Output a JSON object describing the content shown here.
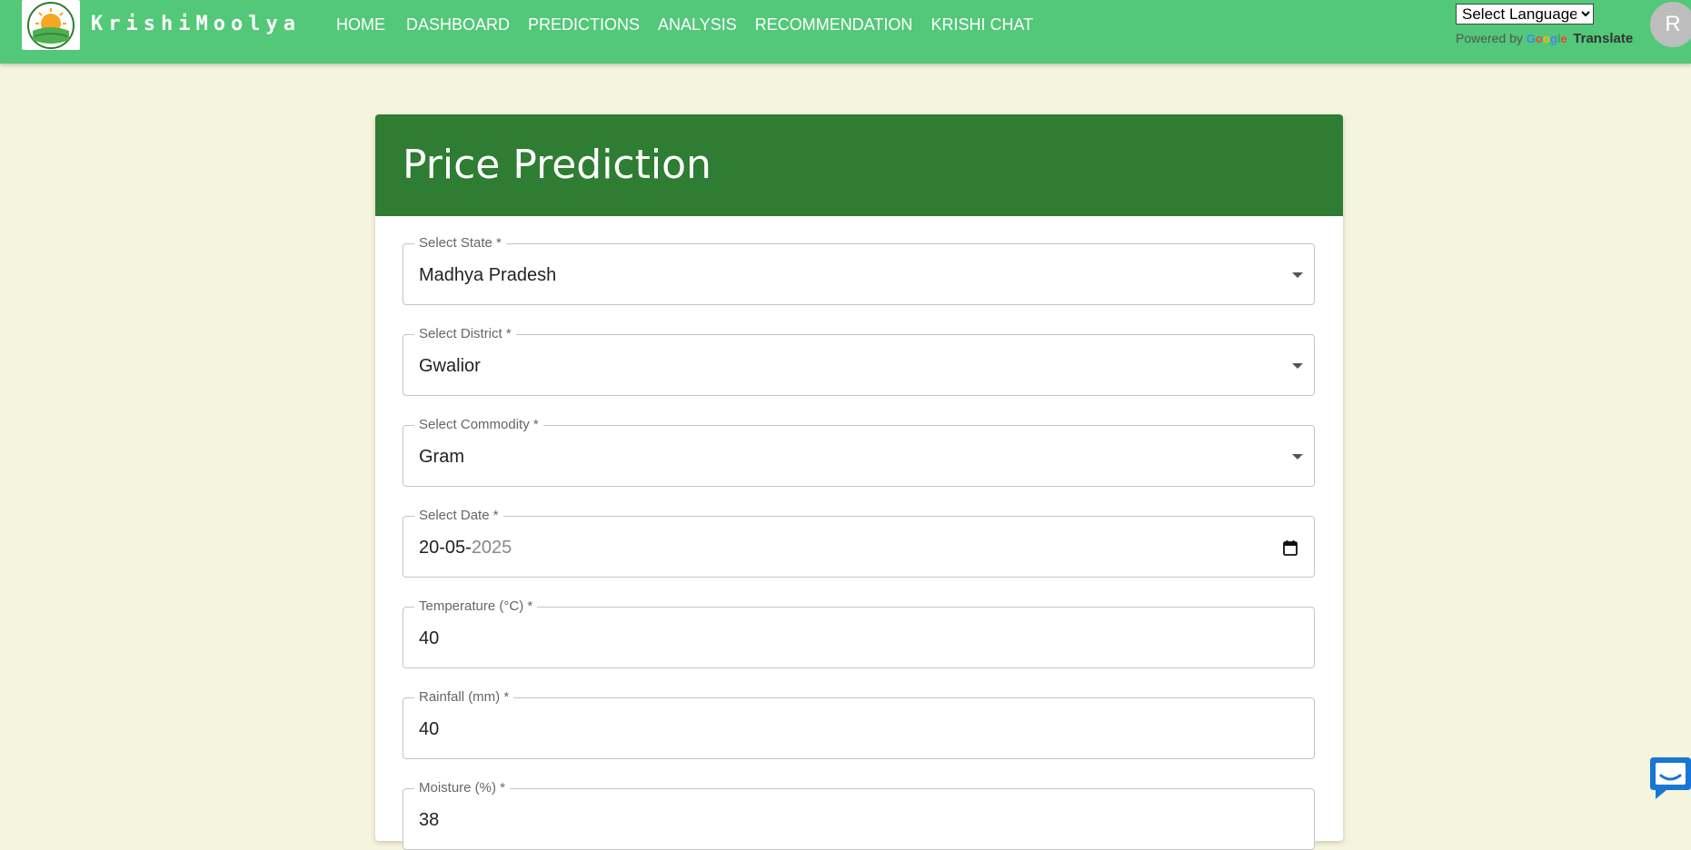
{
  "brand": {
    "name": "KrishiMoolya",
    "logo_icon": "krishimoolya-logo-icon"
  },
  "nav": {
    "items": [
      {
        "label": "HOME"
      },
      {
        "label": "DASHBOARD"
      },
      {
        "label": "PREDICTIONS"
      },
      {
        "label": "ANALYSIS"
      },
      {
        "label": "RECOMMENDATION"
      },
      {
        "label": "KRISHI CHAT"
      }
    ]
  },
  "translate": {
    "select_label": "Select Language",
    "powered_by": "Powered by",
    "google": "Google",
    "translate": "Translate"
  },
  "user": {
    "avatar_initial": "R"
  },
  "form": {
    "title": "Price Prediction",
    "fields": [
      {
        "label": "Select State *",
        "value": "Madhya Pradesh",
        "type": "select"
      },
      {
        "label": "Select District *",
        "value": "Gwalior",
        "type": "select"
      },
      {
        "label": "Select Commodity *",
        "value": "Gram",
        "type": "select"
      },
      {
        "label": "Select Date *",
        "value": "20-05-",
        "value_muted": "2025",
        "type": "date"
      },
      {
        "label": "Temperature (°C) *",
        "value": "40",
        "type": "number"
      },
      {
        "label": "Rainfall (mm) *",
        "value": "40",
        "type": "number"
      },
      {
        "label": "Moisture (%) *",
        "value": "38",
        "type": "number"
      }
    ]
  },
  "colors": {
    "navbar": "#52c878",
    "card_header": "#2e7d32",
    "page_bg": "#f5f4dc",
    "chat_widget": "#1976d2"
  },
  "icons": {
    "dropdown": "chevron-down-icon",
    "calendar": "calendar-icon",
    "chat": "chat-bubble-icon"
  }
}
